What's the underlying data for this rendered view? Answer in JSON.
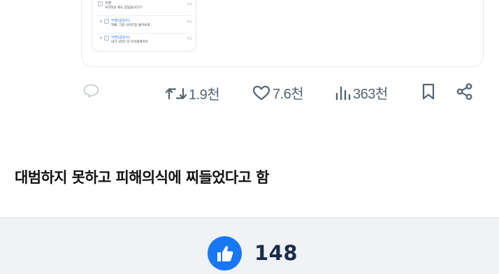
{
  "embedded_screenshot": {
    "comments": [
      {
        "name": "익명",
        "text": "우리학교 에도 있었습니다!!!",
        "meta": "방금",
        "reply": false
      },
      {
        "name": "익명(글쓴이)",
        "text": "뭐예, 그중 사이즈중 불어보게..",
        "meta": "방금",
        "reply": true
      },
      {
        "name": "익명(글쓴이)",
        "text": "내가 1된다 더 우리세계하지",
        "meta": "방금",
        "reply": true
      }
    ]
  },
  "actions": {
    "reply": {
      "icon": "comment-icon",
      "count": ""
    },
    "retweet": {
      "icon": "retweet-icon",
      "count": "1.9천"
    },
    "like": {
      "icon": "heart-icon",
      "count": "7.6천"
    },
    "views": {
      "icon": "bar-chart-icon",
      "count": "363천"
    },
    "bookmark": {
      "icon": "bookmark-icon"
    },
    "share": {
      "icon": "share-icon"
    }
  },
  "post": {
    "text": "대범하지 못하고 피해의식에 찌들었다고 함"
  },
  "footer": {
    "like_icon": "thumbs-up-icon",
    "like_count": "148",
    "accent": "#1877f2"
  }
}
